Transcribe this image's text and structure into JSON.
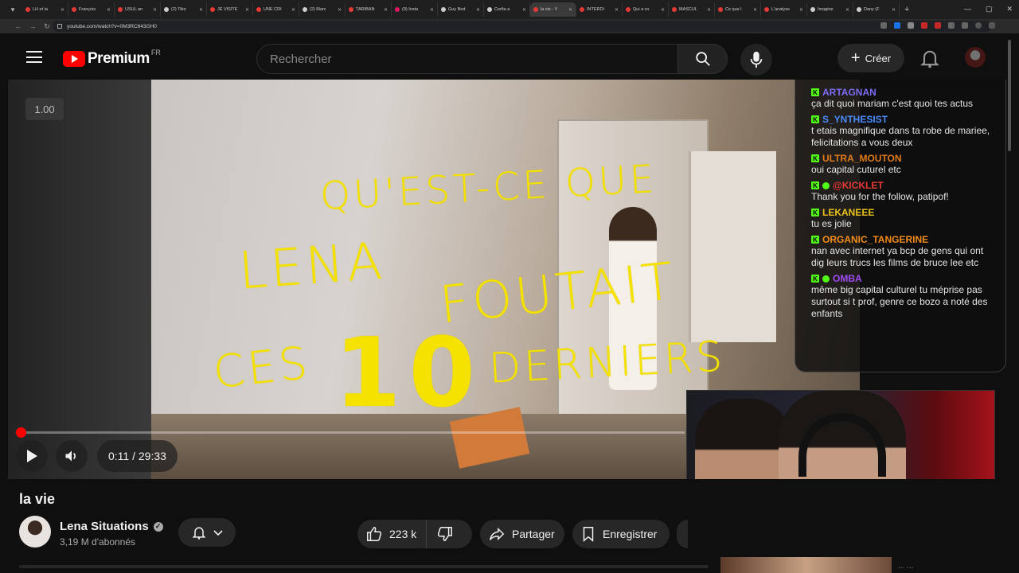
{
  "browser": {
    "tabs": [
      {
        "label": "LH et la ",
        "color": "#e53935"
      },
      {
        "label": "François ",
        "color": "#e53935"
      },
      {
        "label": "USUL an",
        "color": "#e53935"
      },
      {
        "label": "(2) Tibo ",
        "color": "#cccccc"
      },
      {
        "label": "JE VISITE",
        "color": "#e53935"
      },
      {
        "label": "UNE CRI",
        "color": "#e53935"
      },
      {
        "label": "(2) Marc",
        "color": "#cccccc"
      },
      {
        "label": "TARIBAN",
        "color": "#e53935"
      },
      {
        "label": "(9) Insta",
        "color": "#d81b60"
      },
      {
        "label": "Guy Bed",
        "color": "#cccccc"
      },
      {
        "label": "Cerfia a",
        "color": "#cccccc"
      },
      {
        "label": "la vie - Y",
        "color": "#e53935"
      },
      {
        "label": "INTERDI",
        "color": "#e53935"
      },
      {
        "label": "Qui a co",
        "color": "#e53935"
      },
      {
        "label": "MASCUL",
        "color": "#e53935"
      },
      {
        "label": "Ce que l",
        "color": "#e53935"
      },
      {
        "label": "L'analyse",
        "color": "#e53935"
      },
      {
        "label": "Imagine",
        "color": "#cccccc"
      },
      {
        "label": "Dany (F",
        "color": "#cccccc"
      }
    ],
    "active_tab_index": 11,
    "url": "youtube.com/watch?v=0M3RC643GH0",
    "new_tab": "+"
  },
  "header": {
    "brand": "Premium",
    "country": "FR",
    "search_placeholder": "Rechercher",
    "create_label": "Créer"
  },
  "player": {
    "speed": "1.00",
    "time": "0:11 / 29:33",
    "progress_fraction": 0.0062
  },
  "overlay": {
    "line1": "QU'EST-CE QUE",
    "line2": "LENA",
    "line3": "FOUTAIT",
    "line4": "CES",
    "line5": "10",
    "line6": "DERNIERS"
  },
  "chat": [
    {
      "user": "ARTAGNAN",
      "color": "#7b6cf5",
      "text": "ça dit quoi mariam c'est quoi tes actus"
    },
    {
      "user": "S_YNTHESIST",
      "color": "#4a8cff",
      "text": "t etais magnifique dans ta robe de mariee, felicitations a vous deux"
    },
    {
      "user": "ULTRA_MOUTON",
      "color": "#e07b1a",
      "text": "oui capital cuturel etc"
    },
    {
      "user": "@KICKLET",
      "color": "#e53935",
      "text": "Thank you for the follow, patipof!",
      "sub": true
    },
    {
      "user": "LEKANEEE",
      "color": "#e8c21a",
      "text": "tu es jolie"
    },
    {
      "user": "ORGANIC_TANGERINE",
      "color": "#f28c1a",
      "text": "nan avec internet ya bcp de gens qui ont dig leurs trucs les films de bruce lee etc"
    },
    {
      "user": "OMBA",
      "color": "#a04cf5",
      "text": "même big capital culturel tu méprise pas surtout si t prof, genre ce bozo a noté des enfants",
      "sub": true
    }
  ],
  "video": {
    "title": "la vie",
    "channel": "Lena Situations",
    "subscribers": "3,19 M d'abonnés",
    "likes": "223 k",
    "share_label": "Partager",
    "save_label": "Enregistrer"
  },
  "footer": {
    "snippet": "...  ..."
  }
}
